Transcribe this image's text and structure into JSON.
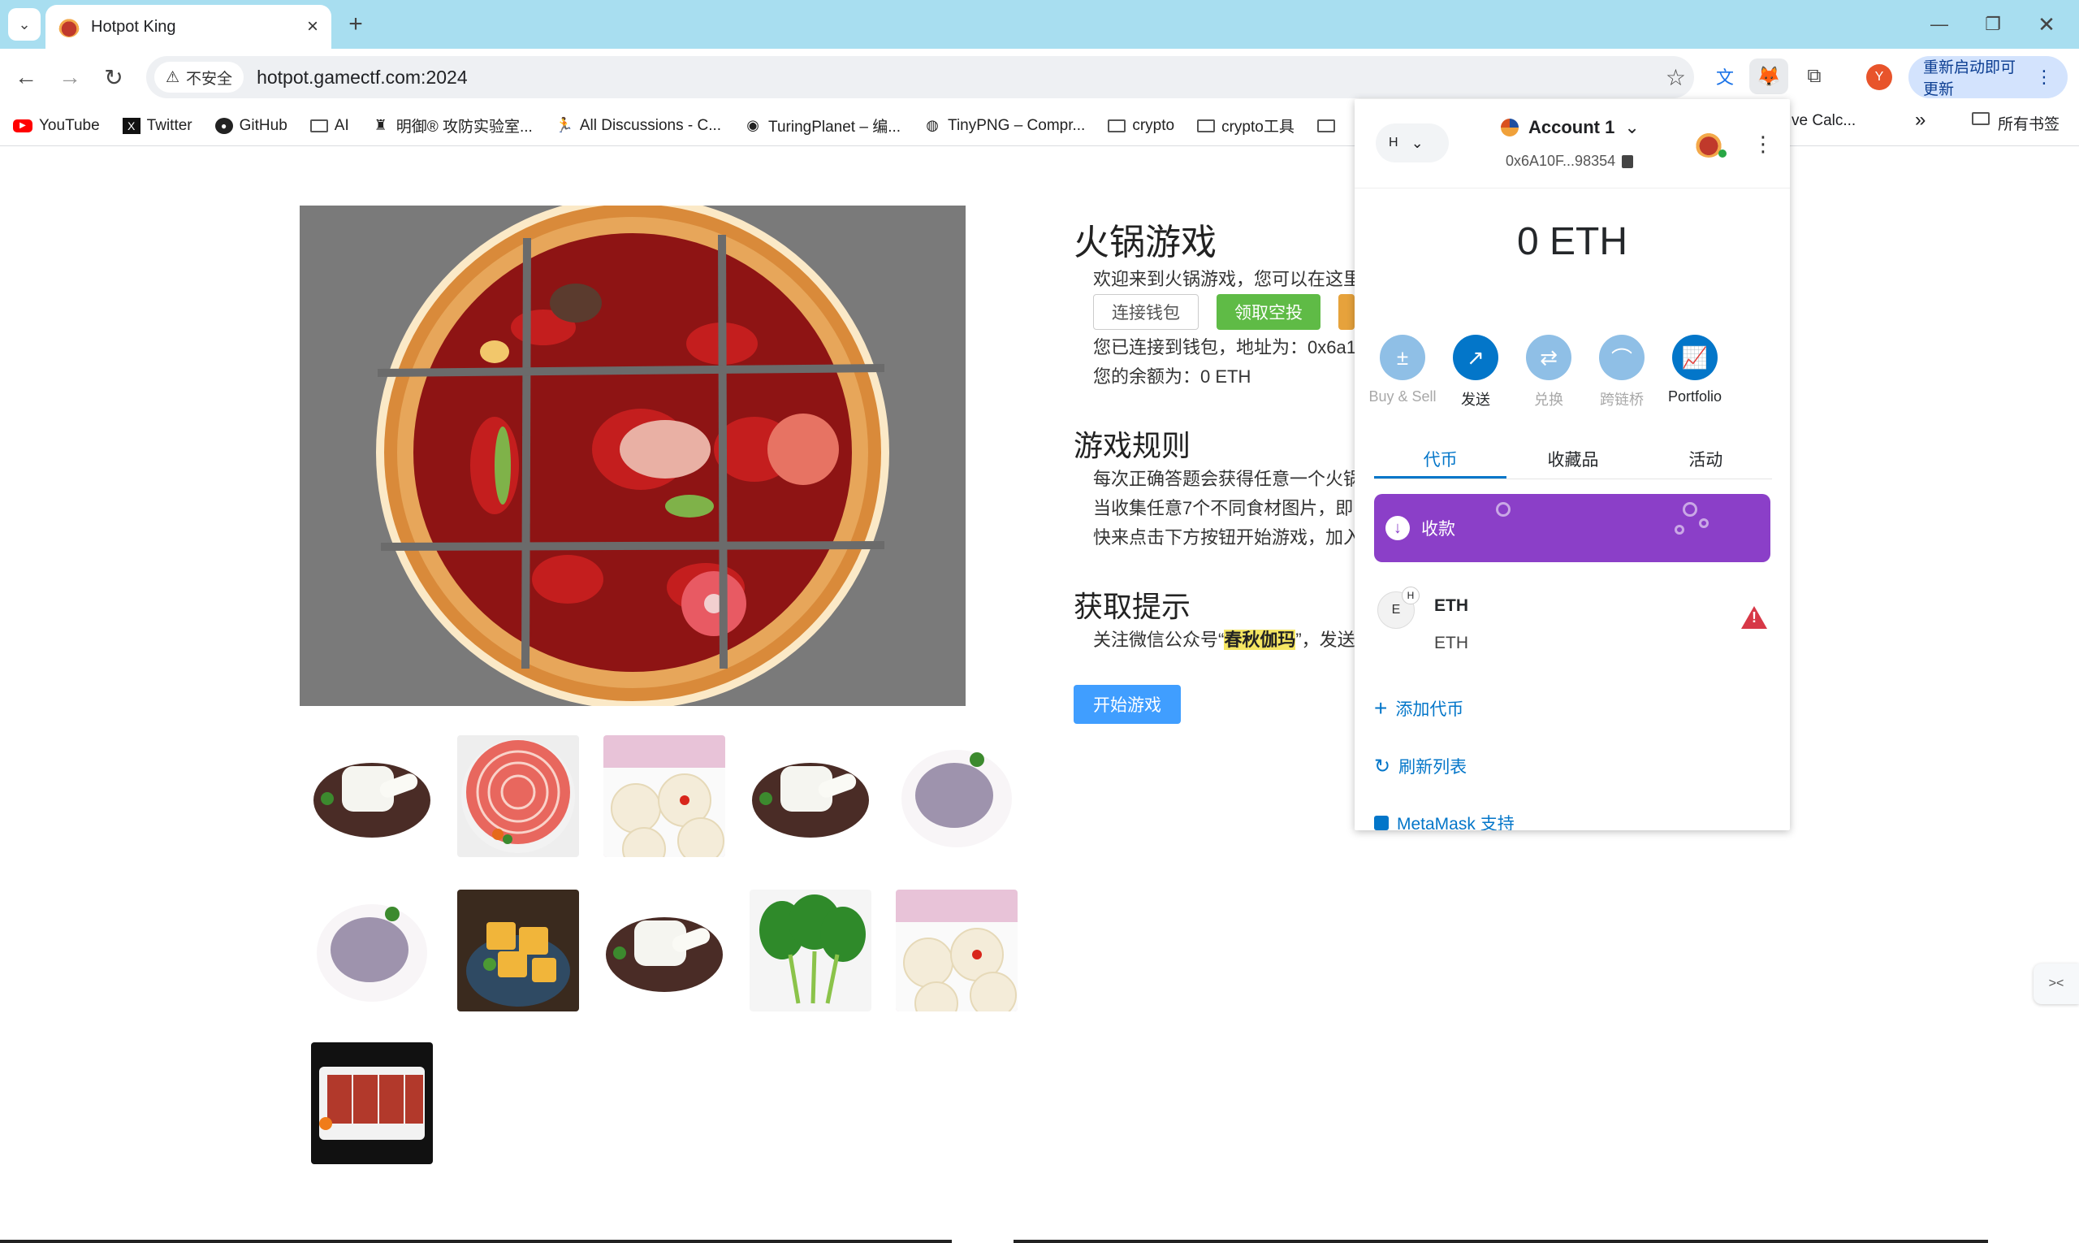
{
  "browser": {
    "tab_title": "Hotpot King",
    "new_tab": "+",
    "security_label": "不安全",
    "url": "hotpot.gamectf.com:2024",
    "update_button": "重新启动即可更新",
    "profile_initial": "Y",
    "bookmarks": [
      {
        "label": "YouTube",
        "icon": "youtube-icon"
      },
      {
        "label": "Twitter",
        "icon": "x-icon"
      },
      {
        "label": "GitHub",
        "icon": "github-icon"
      },
      {
        "label": "AI",
        "icon": "folder-icon"
      },
      {
        "label": "明御® 攻防实验室...",
        "icon": "lab-icon"
      },
      {
        "label": "All Discussions - C...",
        "icon": "runner-icon"
      },
      {
        "label": "TuringPlanet – 编...",
        "icon": "planet-icon"
      },
      {
        "label": "TinyPNG – Compr...",
        "icon": "globe-icon"
      },
      {
        "label": "crypto",
        "icon": "folder-icon"
      },
      {
        "label": "crypto工具",
        "icon": "folder-icon"
      }
    ],
    "bookmark_partial": "ve Calc...",
    "bookmark_more": "»",
    "all_bookmarks": "所有书签"
  },
  "page": {
    "title": "火锅游戏",
    "welcome": "欢迎来到火锅游戏，您可以在这里",
    "connect_button": "连接钱包",
    "airdrop_button": "领取空投",
    "connected_text": "您已连接到钱包，地址为：0x6a1",
    "balance_text": "您的余额为：0 ETH",
    "rules_title": "游戏规则",
    "rules": [
      "每次正确答题会获得任意一个火锅",
      "当收集任意7个不同食材图片，即",
      "快来点击下方按钮开始游戏，加入"
    ],
    "hint_title": "获取提示",
    "hint_prefix": "关注微信公众号“",
    "hint_highlight": "春秋伽玛",
    "hint_suffix": "”，发送",
    "start_button": "开始游戏",
    "ingredients": [
      "rice-cake",
      "beef-slices",
      "lotus-root",
      "rice-cake",
      "shrimp-paste",
      "shrimp-paste",
      "fried-tofu",
      "rice-cake",
      "greens",
      "lotus-root",
      "duck-blood"
    ]
  },
  "metamask": {
    "network_initial": "H",
    "account_name": "Account 1",
    "address": "0x6A10F...98354",
    "balance": "0 ETH",
    "actions": [
      {
        "label": "Buy & Sell",
        "icon": "plus-minus-icon",
        "enabled": false
      },
      {
        "label": "发送",
        "icon": "arrow-up-right-icon",
        "enabled": true
      },
      {
        "label": "兑换",
        "icon": "swap-icon",
        "enabled": false
      },
      {
        "label": "跨链桥",
        "icon": "bridge-icon",
        "enabled": false
      },
      {
        "label": "Portfolio",
        "icon": "chart-icon",
        "enabled": true
      }
    ],
    "tabs": [
      "代币",
      "收藏品",
      "活动"
    ],
    "receive_label": "收款",
    "token_initial": "E",
    "token_badge": "H",
    "token_name": "ETH",
    "token_amount": "ETH",
    "add_token": "添加代币",
    "refresh_list": "刷新列表",
    "support": "MetaMask 支持"
  }
}
